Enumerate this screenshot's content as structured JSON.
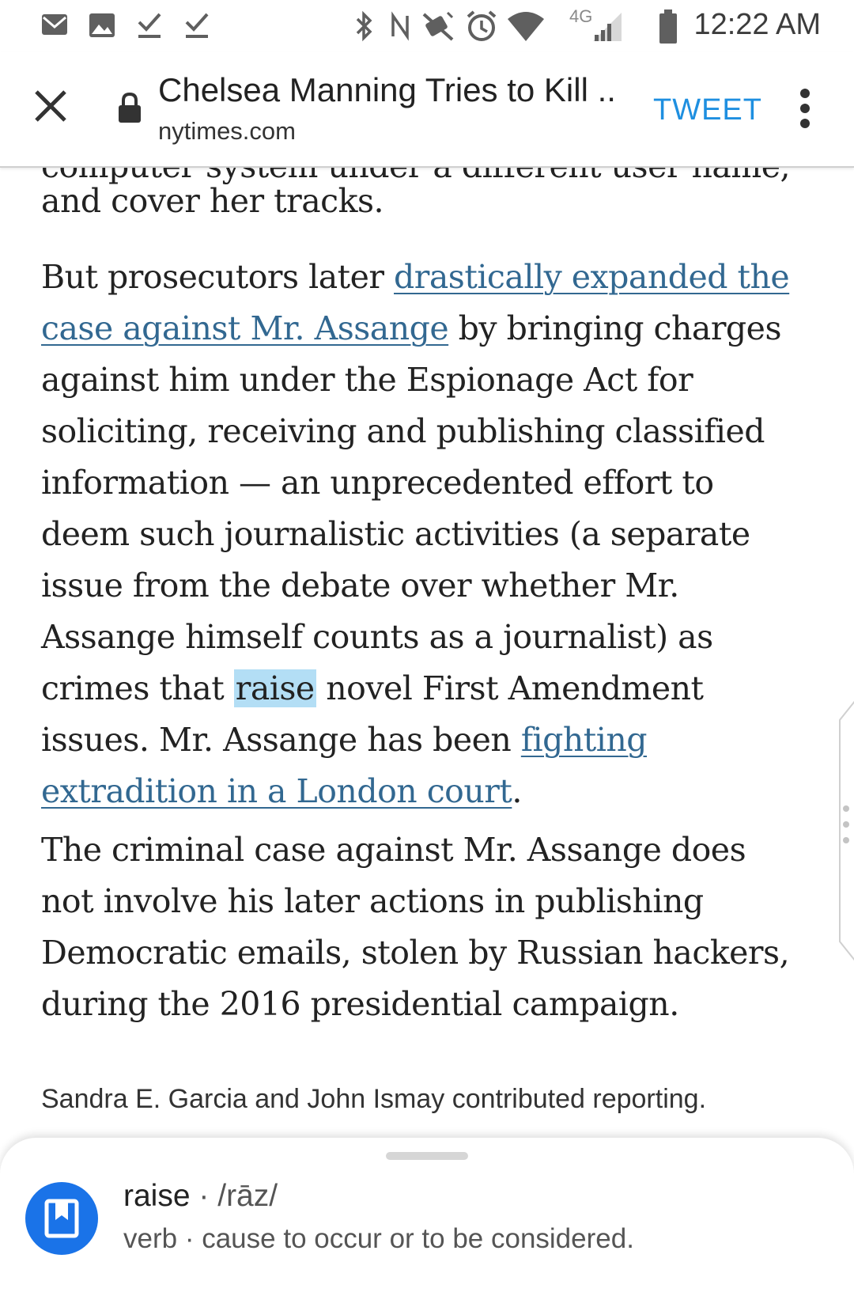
{
  "status_bar": {
    "time": "12:22 AM",
    "network_label": "4G"
  },
  "toolbar": {
    "title": "Chelsea Manning Tries to Kill ...",
    "url": "nytimes.com",
    "tweet_label": "TWEET"
  },
  "article": {
    "cut_line": "computer system under a different user name,",
    "p1": {
      "l1": "and cover her tracks."
    },
    "p2": {
      "l1_a": "But prosecutors later ",
      "l1_link": "drastically expanded the",
      "l2_link": "case against Mr. Assange",
      "l2_b": " by bringing charges",
      "l3": "against him under the Espionage Act for",
      "l4": "soliciting, receiving and publishing classified",
      "l5": "information — an unprecedented effort to",
      "l6": "deem such journalistic activities (a separate",
      "l7": "issue from the debate over whether Mr.",
      "l8": "Assange himself counts as a journalist) as",
      "l9_a": "crimes that ",
      "l9_highlight": "raise",
      "l9_b": " novel First Amendment",
      "l10_a": "issues. Mr. Assange has been ",
      "l10_link": "fighting",
      "l11_link": "extradition in a London court",
      "l11_b": "."
    },
    "p3": {
      "l1": "The criminal case against Mr. Assange does",
      "l2": "not involve his later actions in publishing",
      "l3": "Democratic emails, stolen by Russian hackers,",
      "l4": "during the 2016 presidential campaign."
    },
    "credit": "Sandra E. Garcia and John Ismay contributed reporting."
  },
  "definition": {
    "term": "raise",
    "separator": "·",
    "pronunciation": "/rāz/",
    "part_of_speech": "verb",
    "meaning": "cause to occur or to be considered."
  },
  "colors": {
    "link": "#326891",
    "highlight": "#b3def5",
    "accent_blue": "#1a73e8",
    "tweet_blue": "#1e8fe0"
  }
}
